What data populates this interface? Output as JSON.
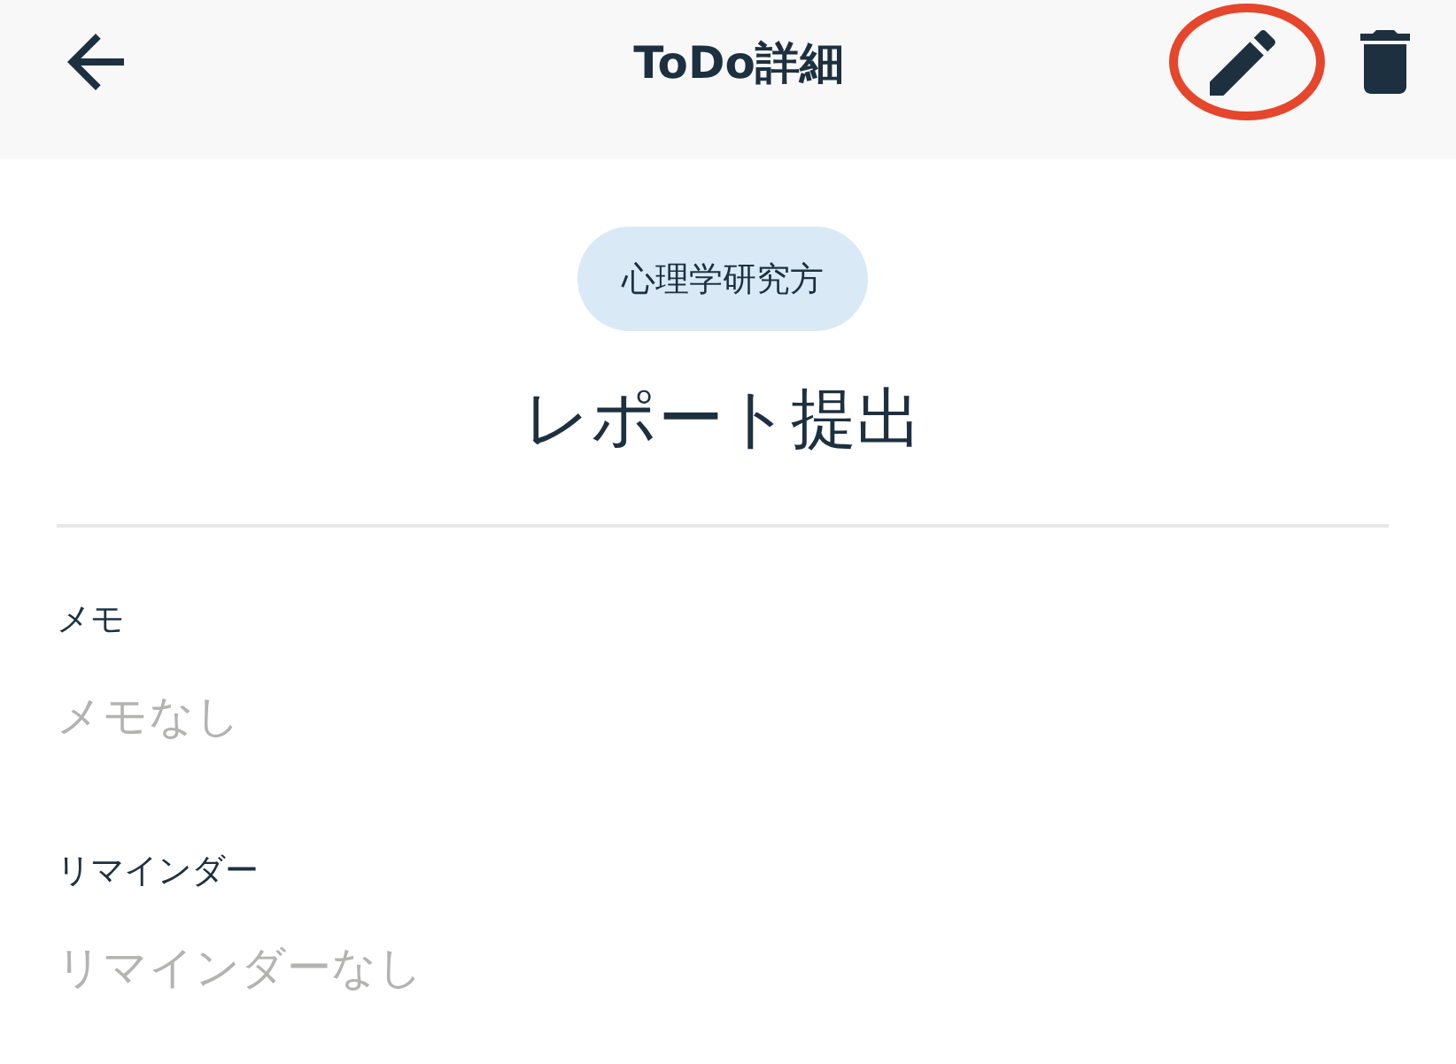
{
  "header": {
    "title": "ToDo詳細",
    "edit_button": {
      "highlighted": true
    }
  },
  "category": {
    "label": "心理学研究方"
  },
  "todo_title": "レポート提出",
  "fields": [
    {
      "label": "メモ",
      "value": "メモなし",
      "empty": true
    },
    {
      "label": "リマインダー",
      "value": "リマインダーなし",
      "empty": true
    }
  ]
}
